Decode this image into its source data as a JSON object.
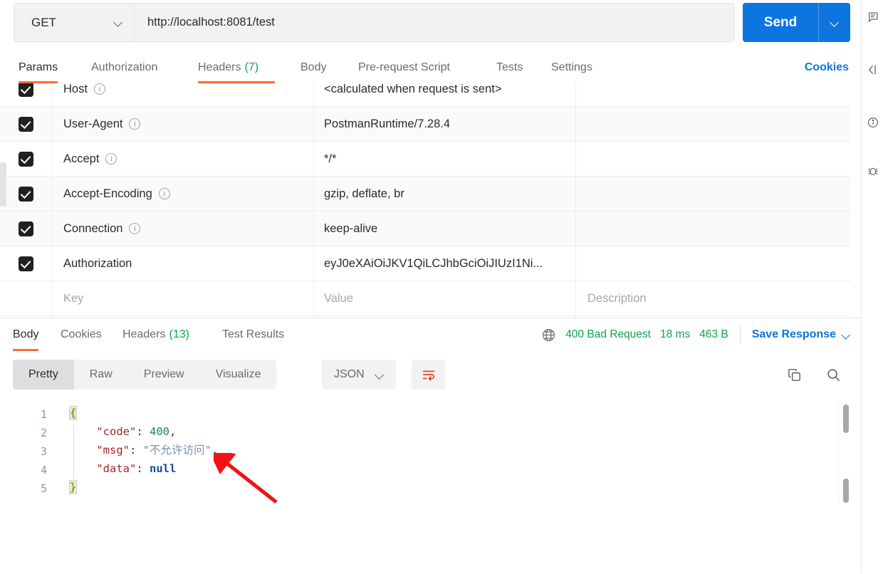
{
  "request": {
    "method": "GET",
    "url": "http://localhost:8081/test",
    "send_label": "Send",
    "tabs": [
      {
        "label": "Params",
        "count": ""
      },
      {
        "label": "Authorization",
        "count": ""
      },
      {
        "label": "Headers",
        "count": "(7)"
      },
      {
        "label": "Body",
        "count": ""
      },
      {
        "label": "Pre-request Script",
        "count": ""
      },
      {
        "label": "Tests",
        "count": ""
      },
      {
        "label": "Settings",
        "count": ""
      }
    ],
    "active_tab": "Headers",
    "cookies_link": "Cookies"
  },
  "headers_table": {
    "columns": [
      "Key",
      "Value",
      "Description"
    ],
    "placeholder_key": "Key",
    "placeholder_value": "Value",
    "placeholder_description": "Description",
    "rows": [
      {
        "checked": true,
        "key": "Host",
        "info": true,
        "value": "<calculated when request is sent>",
        "description": ""
      },
      {
        "checked": true,
        "key": "User-Agent",
        "info": true,
        "value": "PostmanRuntime/7.28.4",
        "description": ""
      },
      {
        "checked": true,
        "key": "Accept",
        "info": true,
        "value": "*/*",
        "description": ""
      },
      {
        "checked": true,
        "key": "Accept-Encoding",
        "info": true,
        "value": "gzip, deflate, br",
        "description": ""
      },
      {
        "checked": true,
        "key": "Connection",
        "info": true,
        "value": "keep-alive",
        "description": ""
      },
      {
        "checked": true,
        "key": "Authorization",
        "info": false,
        "value": "eyJ0eXAiOiJKV1QiLCJhbGciOiJIUzI1Ni...",
        "description": ""
      }
    ]
  },
  "response": {
    "tabs": [
      {
        "label": "Body",
        "count": ""
      },
      {
        "label": "Cookies",
        "count": ""
      },
      {
        "label": "Headers",
        "count": "(13)"
      },
      {
        "label": "Test Results",
        "count": ""
      }
    ],
    "active_tab": "Body",
    "status_text": "400 Bad Request",
    "time_text": "18 ms",
    "size_text": "463 B",
    "save_response_label": "Save Response",
    "status_color": "#10a44b",
    "globe_icon": "globe-icon"
  },
  "body_toolbar": {
    "formats": [
      "Pretty",
      "Raw",
      "Preview",
      "Visualize"
    ],
    "active_format": "Pretty",
    "language": "JSON",
    "wrap_icon": "word-wrap-icon",
    "copy_icon": "copy-icon",
    "search_icon": "search-icon",
    "accent_color": "#ff6c37"
  },
  "code": {
    "line_numbers": [
      "1",
      "2",
      "3",
      "4",
      "5"
    ],
    "lines": [
      {
        "n": 1,
        "tokens": [
          {
            "t": "{",
            "c": "brace-hl"
          }
        ]
      },
      {
        "n": 2,
        "tokens": [
          {
            "t": "    ",
            "c": "tok-punct"
          },
          {
            "t": "\"code\"",
            "c": "tok-key"
          },
          {
            "t": ": ",
            "c": "tok-punct"
          },
          {
            "t": "400",
            "c": "tok-num"
          },
          {
            "t": ",",
            "c": "tok-punct"
          }
        ]
      },
      {
        "n": 3,
        "tokens": [
          {
            "t": "    ",
            "c": "tok-punct"
          },
          {
            "t": "\"msg\"",
            "c": "tok-key"
          },
          {
            "t": ": ",
            "c": "tok-punct"
          },
          {
            "t": "\"不允许访问\"",
            "c": "tok-str"
          },
          {
            "t": ",",
            "c": "tok-punct"
          }
        ]
      },
      {
        "n": 4,
        "tokens": [
          {
            "t": "    ",
            "c": "tok-punct"
          },
          {
            "t": "\"data\"",
            "c": "tok-key"
          },
          {
            "t": ": ",
            "c": "tok-punct"
          },
          {
            "t": "null",
            "c": "tok-null"
          }
        ]
      },
      {
        "n": 5,
        "tokens": [
          {
            "t": "}",
            "c": "brace-hl"
          }
        ]
      }
    ],
    "json_value": {
      "code": 400,
      "msg": "不允许访问",
      "data": null
    }
  },
  "annotation": {
    "type": "red-arrow",
    "color": "#f01414",
    "points_to": "不允许访问"
  },
  "right_sidebar": {
    "icons": [
      "comment-icon",
      "collapse-panel-icon",
      "info-circle-icon",
      "bug-icon"
    ]
  }
}
